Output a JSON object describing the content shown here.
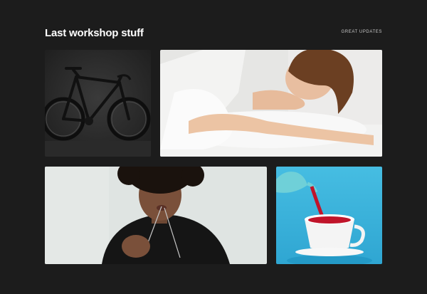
{
  "header": {
    "title": "Last workshop stuff",
    "link_label": "GREAT UPDATES"
  },
  "gallery": {
    "tiles": [
      {
        "subject": "black road bicycle"
      },
      {
        "subject": "woman resting on pillow"
      },
      {
        "subject": "woman holding glasses"
      },
      {
        "subject": "pouring red tea into white cup"
      }
    ]
  },
  "colors": {
    "background": "#1c1c1c",
    "title": "#ffffff",
    "link": "#c9c9c9",
    "tea_bg": "#3fb6dd"
  }
}
